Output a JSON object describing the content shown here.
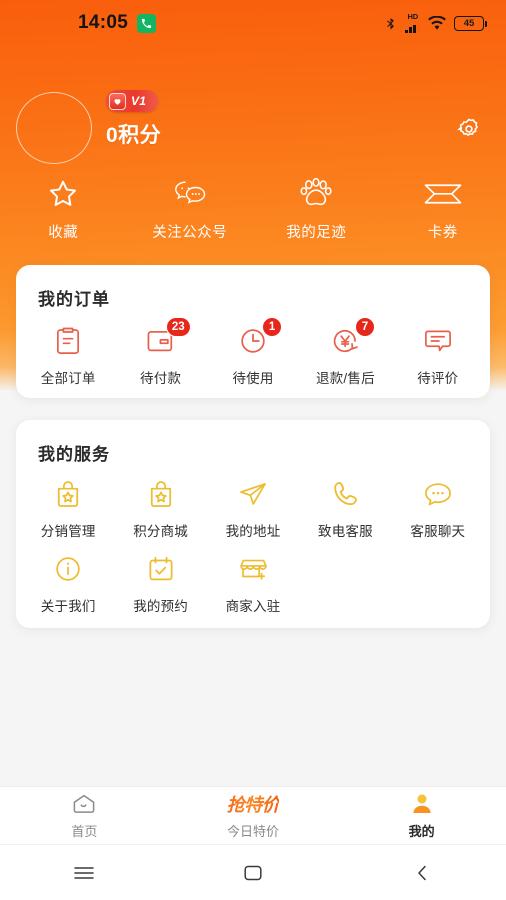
{
  "status_bar": {
    "time": "14:05",
    "call_icon": "phone-icon",
    "bluetooth_icon": "bluetooth-icon",
    "network_label": "HD",
    "signal_icon": "signal-bars-icon",
    "wifi_icon": "wifi-icon",
    "battery_level": "45"
  },
  "profile": {
    "avatar": "avatar-placeholder",
    "level_badge": "V1",
    "level_icon": "heart-shield-icon",
    "points": "0积分",
    "settings_icon": "gear-icon"
  },
  "quick_actions": [
    {
      "label": "收藏",
      "icon": "star-icon"
    },
    {
      "label": "关注公众号",
      "icon": "chat-bubbles-icon"
    },
    {
      "label": "我的足迹",
      "icon": "paw-icon"
    },
    {
      "label": "卡券",
      "icon": "ticket-icon"
    }
  ],
  "orders": {
    "title": "我的订单",
    "items": [
      {
        "label": "全部订单",
        "icon": "clipboard-icon",
        "badge": ""
      },
      {
        "label": "待付款",
        "icon": "wallet-icon",
        "badge": "23"
      },
      {
        "label": "待使用",
        "icon": "clock-icon",
        "badge": "1"
      },
      {
        "label": "退款/售后",
        "icon": "refund-yuan-icon",
        "badge": "7"
      },
      {
        "label": "待评价",
        "icon": "comment-icon",
        "badge": ""
      }
    ]
  },
  "services": {
    "title": "我的服务",
    "row1": [
      {
        "label": "分销管理",
        "icon": "bag-star-icon"
      },
      {
        "label": "积分商城",
        "icon": "bag-star-icon"
      },
      {
        "label": "我的地址",
        "icon": "paper-plane-icon"
      },
      {
        "label": "致电客服",
        "icon": "phone-handset-icon"
      },
      {
        "label": "客服聊天",
        "icon": "chat-dots-icon"
      }
    ],
    "row2": [
      {
        "label": "关于我们",
        "icon": "info-circle-icon"
      },
      {
        "label": "我的预约",
        "icon": "calendar-check-icon"
      },
      {
        "label": "商家入驻",
        "icon": "storefront-plus-icon"
      }
    ]
  },
  "tab_bar": {
    "tabs": [
      {
        "label": "首页",
        "icon": "home-icon",
        "active": false
      },
      {
        "label": "今日特价",
        "icon": "qiangtejia-logo",
        "logo_text": "抢特价",
        "active": false
      },
      {
        "label": "我的",
        "icon": "person-icon",
        "active": true
      }
    ]
  },
  "nav_bar": {
    "recents_icon": "menu-icon",
    "home_icon": "square-icon",
    "back_icon": "chevron-left-icon"
  },
  "colors": {
    "header_top": "#f95e0c",
    "header_bottom": "#fdae46",
    "badge_red": "#e8271c",
    "order_icon": "#e8604c",
    "service_icon": "#eebc2f",
    "page_bg": "#f5f5f5"
  }
}
